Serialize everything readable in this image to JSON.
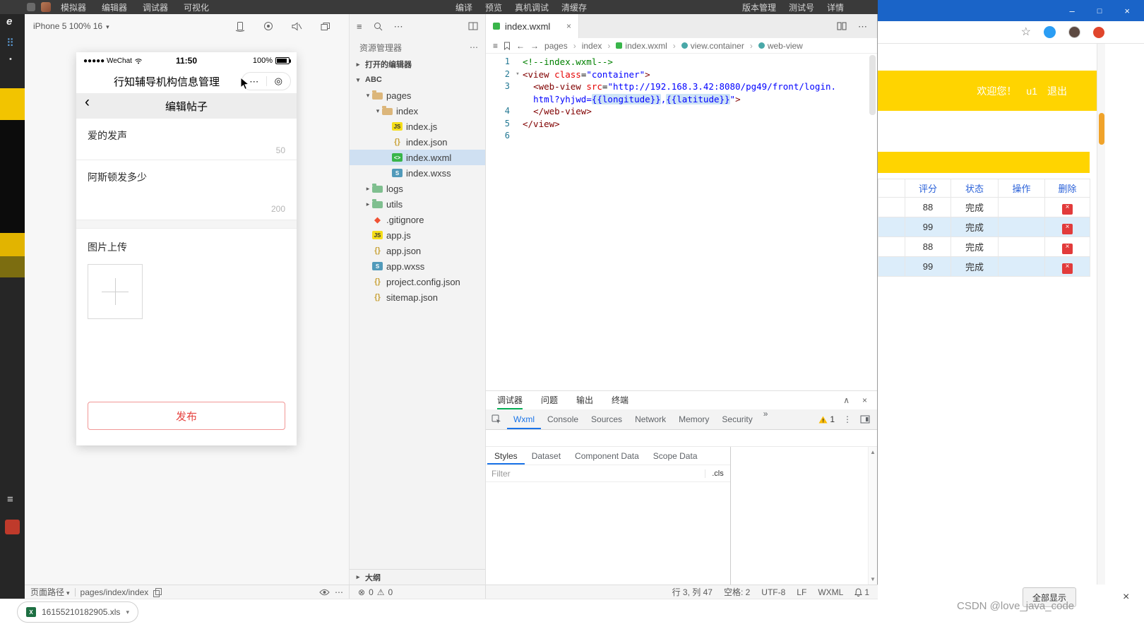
{
  "menubar": {
    "left": [
      "模拟器",
      "编辑器",
      "调试器",
      "可视化"
    ],
    "center": [
      "编译",
      "预览",
      "真机调试",
      "清缓存"
    ],
    "right": [
      "版本管理",
      "测试号",
      "详情"
    ]
  },
  "simulator": {
    "device": "iPhone 5 100% 16",
    "status": {
      "carrier": "●●●●● WeChat",
      "time": "11:50",
      "battery": "100%"
    },
    "app_title": "行知辅导机构信息管理",
    "nav_title": "编辑帖子",
    "form": {
      "title_value": "爱的发声",
      "title_counter": "50",
      "content_value": "阿斯顿发多少",
      "content_counter": "200",
      "upload_label": "图片上传",
      "publish_label": "发布"
    },
    "footer": {
      "path_label": "页面路径",
      "path_value": "pages/index/index"
    }
  },
  "explorer": {
    "title": "资源管理器",
    "open_editors": "打开的编辑器",
    "project": "ABC",
    "outline": "大纲",
    "tree": [
      {
        "label": "pages",
        "icon": "folder-open",
        "indent": 1,
        "chev": true,
        "expanded": true
      },
      {
        "label": "index",
        "icon": "folder-open",
        "indent": 2,
        "chev": true,
        "expanded": true
      },
      {
        "label": "index.js",
        "icon": "js",
        "indent": 3
      },
      {
        "label": "index.json",
        "icon": "json",
        "indent": 3
      },
      {
        "label": "index.wxml",
        "icon": "wxml",
        "indent": 3,
        "selected": true
      },
      {
        "label": "index.wxss",
        "icon": "wxss",
        "indent": 3
      },
      {
        "label": "logs",
        "icon": "folder-green",
        "indent": 1,
        "chev": true,
        "expanded": false
      },
      {
        "label": "utils",
        "icon": "folder-green",
        "indent": 1,
        "chev": true,
        "expanded": false
      },
      {
        "label": ".gitignore",
        "icon": "git",
        "indent": 1
      },
      {
        "label": "app.js",
        "icon": "js",
        "indent": 1
      },
      {
        "label": "app.json",
        "icon": "json",
        "indent": 1
      },
      {
        "label": "app.wxss",
        "icon": "wxss",
        "indent": 1
      },
      {
        "label": "project.config.json",
        "icon": "json",
        "indent": 1
      },
      {
        "label": "sitemap.json",
        "icon": "json",
        "indent": 1
      }
    ]
  },
  "editor": {
    "tab": "index.wxml",
    "breadcrumb": [
      "pages",
      "index",
      "index.wxml",
      "view.container",
      "web-view"
    ],
    "lines": [
      {
        "n": "1",
        "seg": [
          {
            "c": "comment",
            "t": "<!--index.wxml-->"
          }
        ]
      },
      {
        "n": "2",
        "fold": true,
        "seg": [
          {
            "c": "tag",
            "t": "<view"
          },
          {
            "c": "plain",
            "t": " "
          },
          {
            "c": "attr",
            "t": "class"
          },
          {
            "c": "plain",
            "t": "="
          },
          {
            "c": "str",
            "t": "\"container\""
          },
          {
            "c": "tag",
            "t": ">"
          }
        ]
      },
      {
        "n": "3",
        "seg": [
          {
            "c": "plain",
            "t": "  "
          },
          {
            "c": "tag",
            "t": "<web-view"
          },
          {
            "c": "plain",
            "t": " "
          },
          {
            "c": "attr",
            "t": "src"
          },
          {
            "c": "plain",
            "t": "="
          },
          {
            "c": "str",
            "t": "\"http://192.168.3.42:8080/pg49/front/login."
          }
        ]
      },
      {
        "n": "",
        "seg": [
          {
            "c": "plain",
            "t": "  "
          },
          {
            "c": "str",
            "t": "html?yhjwd="
          },
          {
            "c": "expr",
            "t": "{{longitude}}"
          },
          {
            "c": "str",
            "t": ","
          },
          {
            "c": "expr",
            "t": "{{latitude}}"
          },
          {
            "c": "str",
            "t": "\""
          },
          {
            "c": "tag",
            "t": ">"
          }
        ]
      },
      {
        "n": "4",
        "seg": [
          {
            "c": "plain",
            "t": "  "
          },
          {
            "c": "tag",
            "t": "</web-view>"
          }
        ]
      },
      {
        "n": "5",
        "seg": [
          {
            "c": "tag",
            "t": "</view>"
          }
        ]
      },
      {
        "n": "6",
        "seg": []
      }
    ]
  },
  "debugger": {
    "panel_tabs": [
      "调试器",
      "问题",
      "输出",
      "终端"
    ],
    "devtools_tabs": [
      "Wxml",
      "Console",
      "Sources",
      "Network",
      "Memory",
      "Security"
    ],
    "warning_count": "1",
    "inspector_tabs": [
      "Styles",
      "Dataset",
      "Component Data",
      "Scope Data"
    ],
    "filter_placeholder": "Filter",
    "cls_label": ".cls"
  },
  "statusbar": {
    "errors": "0",
    "warnings": "0",
    "cursor": "行 3, 列 47",
    "spaces": "空格: 2",
    "encoding": "UTF-8",
    "eol": "LF",
    "language": "WXML",
    "bell_count": "1"
  },
  "browser": {
    "header": {
      "welcome": "欢迎您！",
      "user": "u1",
      "logout": "退出"
    },
    "table": {
      "headers": [
        "评分",
        "状态",
        "操作",
        "删除"
      ],
      "rows": [
        {
          "score": "88",
          "status": "完成"
        },
        {
          "score": "99",
          "status": "完成"
        },
        {
          "score": "88",
          "status": "完成"
        },
        {
          "score": "99",
          "status": "完成"
        }
      ]
    },
    "show_all": "全部显示",
    "watermark": "CSDN @love_java_code"
  },
  "downloads": {
    "filename": "16155210182905.xls"
  }
}
